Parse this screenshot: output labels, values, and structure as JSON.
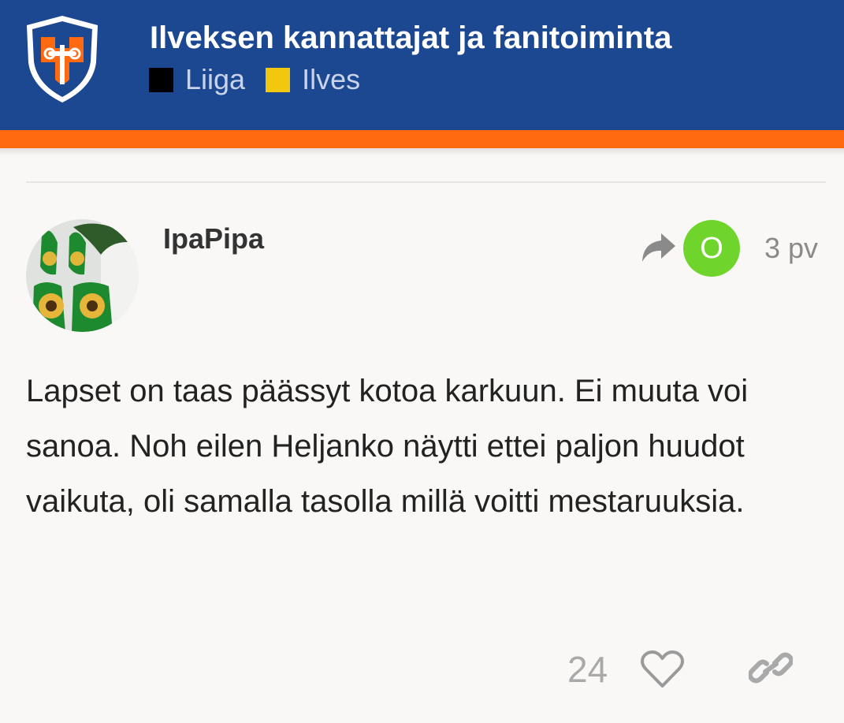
{
  "header": {
    "title": "Ilveksen kannattajat ja fanitoiminta",
    "background_color": "#1c4892",
    "stripe_color": "#ff6a10",
    "logo_icon": "ilves-crest-icon",
    "categories": [
      {
        "label": "Liiga",
        "color": "#000000"
      },
      {
        "label": "Ilves",
        "color": "#f2c80f"
      }
    ]
  },
  "post": {
    "username": "IpaPipa",
    "avatar_icon": "user-avatar-photo",
    "reply_to": {
      "icon": "share-arrow-icon",
      "initial": "O",
      "avatar_color": "#6fd52d"
    },
    "date": "3 pv",
    "body": "Lapset on taas päässyt kotoa karkuun. Ei muuta voi sanoa. Noh eilen Heljanko näytti ettei paljon huudot vaikuta, oli samalla tasolla millä voitti mestaruuksia.",
    "likes": "24",
    "like_icon": "heart-icon",
    "share_icon": "link-icon"
  }
}
